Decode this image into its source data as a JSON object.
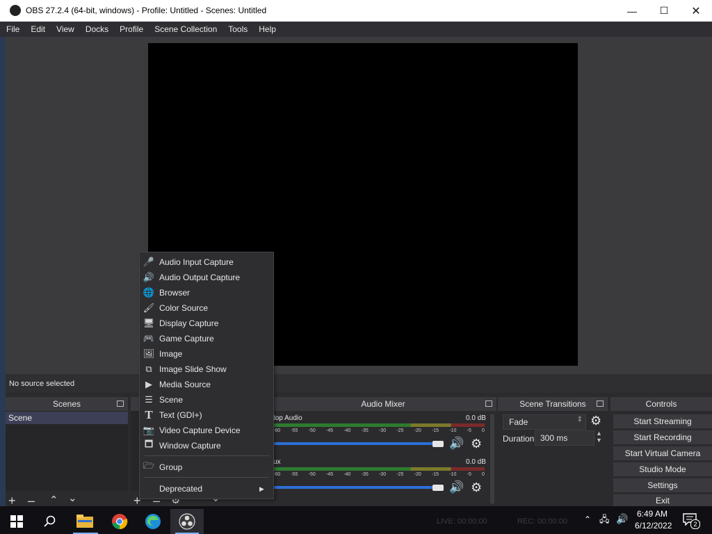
{
  "window": {
    "title": "OBS 27.2.4 (64-bit, windows) - Profile: Untitled - Scenes: Untitled",
    "min_icon": "minimize-icon",
    "max_icon": "maximize-icon",
    "close_icon": "close-icon"
  },
  "menubar": [
    "File",
    "Edit",
    "View",
    "Docks",
    "Profile",
    "Scene Collection",
    "Tools",
    "Help"
  ],
  "source_bar": {
    "text": "No source selected"
  },
  "docks": {
    "scenes": {
      "title": "Scenes",
      "items": [
        "Scene"
      ]
    },
    "audio_mixer": {
      "title": "Audio Mixer",
      "tracks": [
        {
          "name": "top Audio",
          "db": "0.0 dB"
        },
        {
          "name": "ux",
          "db": "0.0 dB"
        }
      ],
      "ticks": [
        "-60",
        "-55",
        "-50",
        "-45",
        "-40",
        "-35",
        "-30",
        "-25",
        "-20",
        "-15",
        "-10",
        "-5",
        "0"
      ]
    },
    "scene_transitions": {
      "title": "Scene Transitions",
      "transition": "Fade",
      "duration_label": "Duration",
      "duration_value": "300 ms"
    },
    "controls": {
      "title": "Controls",
      "buttons": [
        "Start Streaming",
        "Start Recording",
        "Start Virtual Camera",
        "Studio Mode",
        "Settings",
        "Exit"
      ]
    }
  },
  "context_menu": {
    "items": [
      {
        "label": "Audio Input Capture",
        "icon": "microphone-icon"
      },
      {
        "label": "Audio Output Capture",
        "icon": "speaker-icon"
      },
      {
        "label": "Browser",
        "icon": "globe-icon"
      },
      {
        "label": "Color Source",
        "icon": "brush-icon"
      },
      {
        "label": "Display Capture",
        "icon": "monitor-icon"
      },
      {
        "label": "Game Capture",
        "icon": "gamepad-icon"
      },
      {
        "label": "Image",
        "icon": "image-icon"
      },
      {
        "label": "Image Slide Show",
        "icon": "slideshow-icon"
      },
      {
        "label": "Media Source",
        "icon": "play-icon"
      },
      {
        "label": "Scene",
        "icon": "list-icon"
      },
      {
        "label": "Text (GDI+)",
        "icon": "text-icon"
      },
      {
        "label": "Video Capture Device",
        "icon": "camera-icon"
      },
      {
        "label": "Window Capture",
        "icon": "window-icon"
      }
    ],
    "group_label": "Group",
    "deprecated_label": "Deprecated"
  },
  "taskbar": {
    "status_live": "LIVE: 00:00:00",
    "status_rec": "REC: 00:00:00",
    "time": "6:49 AM",
    "date": "6/12/2022",
    "notifications": "2"
  }
}
